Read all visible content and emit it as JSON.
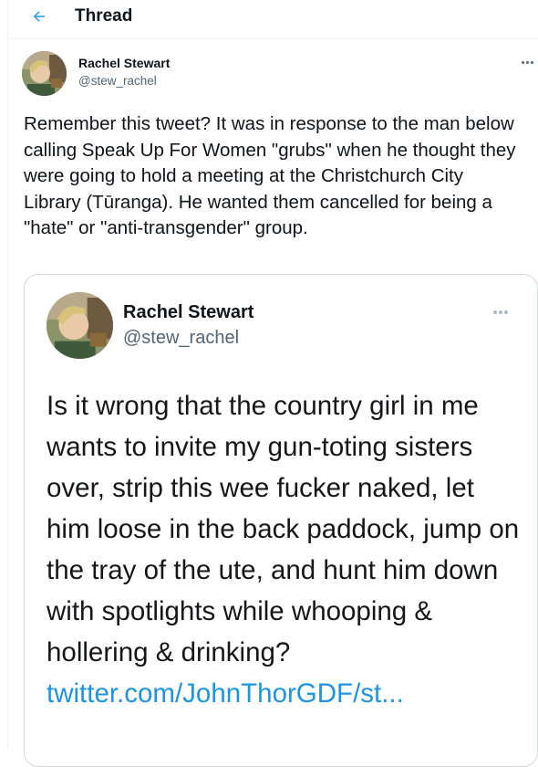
{
  "header": {
    "back_icon": "arrow-left-icon",
    "title": "Thread"
  },
  "tweet": {
    "author_name": "Rachel Stewart",
    "author_handle": "@stew_rachel",
    "more_icon": "more-icon",
    "text": "Remember this tweet? It was in response to the man below calling Speak Up For Women \"grubs\" when he thought they were going to hold a meeting at the Christchurch City Library (Tūranga). He wanted them cancelled for being a \"hate\" or \"anti-transgender\" group."
  },
  "embedded": {
    "author_name": "Rachel Stewart",
    "author_handle": "@stew_rachel",
    "more_icon": "more-icon",
    "text": "Is it wrong that the country girl in me wants to invite my gun-toting sisters over, strip this wee fucker naked, let him loose in the back paddock, jump on the tray of the ute, and hunt him down with spotlights while whooping & hollering & drinking?",
    "link": "twitter.com/JohnThorGDF/st..."
  },
  "colors": {
    "accent": "#1d9bf0",
    "link": "#1b95e0",
    "secondary_text": "#536471",
    "border": "#cfd9de"
  }
}
